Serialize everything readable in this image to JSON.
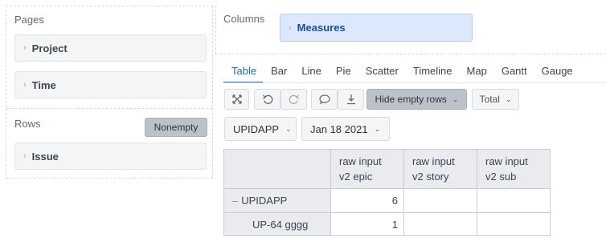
{
  "pages": {
    "title": "Pages",
    "items": [
      {
        "label": "Project"
      },
      {
        "label": "Time"
      }
    ]
  },
  "rows": {
    "title": "Rows",
    "nonempty_label": "Nonempty",
    "items": [
      {
        "label": "Issue"
      }
    ]
  },
  "columns": {
    "title": "Columns",
    "items": [
      {
        "label": "Measures"
      }
    ]
  },
  "tabs": [
    "Table",
    "Bar",
    "Line",
    "Pie",
    "Scatter",
    "Timeline",
    "Map",
    "Gantt",
    "Gauge"
  ],
  "active_tab": "Table",
  "toolbar": {
    "hide_empty_rows_label": "Hide empty rows",
    "total_label": "Total"
  },
  "filters": {
    "project": "UPIDAPP",
    "date": "Jan 18 2021"
  },
  "table": {
    "headers": [
      {
        "line1": "raw input",
        "line2": "v2 epic"
      },
      {
        "line1": "raw input",
        "line2": "v2 story"
      },
      {
        "line1": "raw input",
        "line2": "v2 sub"
      }
    ],
    "rows": [
      {
        "label": "UPIDAPP",
        "values": [
          "6",
          "",
          ""
        ]
      },
      {
        "label": "UP-64 gggg",
        "values": [
          "1",
          "",
          ""
        ]
      }
    ]
  },
  "colors": {
    "accent": "#1e66c9",
    "measures_bg": "#dce8fb",
    "pressed_button": "#bcc2ca"
  }
}
